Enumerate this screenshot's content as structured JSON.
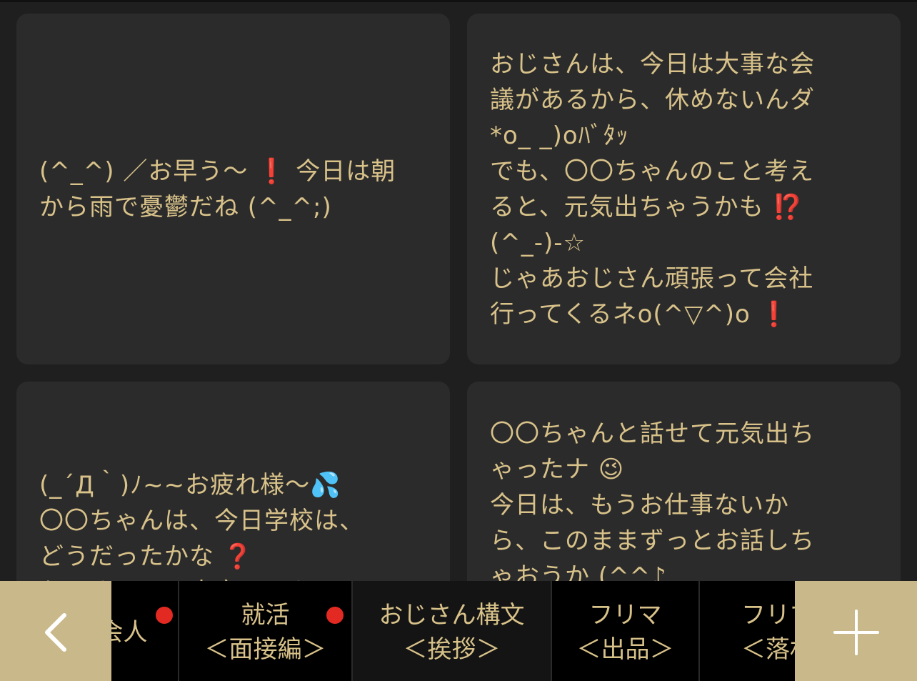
{
  "cards": [
    {
      "lines": [
        "(^_^) ／お早う～ ❗ 今日は朝",
        "から雨で憂鬱だね (^_^;)"
      ]
    },
    {
      "lines": [
        "おじさんは、今日は大事な会",
        "議があるから、休めないんダ",
        "*o_ _)oﾊﾞﾀｯ",
        "でも、〇〇ちゃんのこと考え",
        "ると、元気出ちゃうかも ⁉️",
        "(^_-)-☆",
        "じゃあおじさん頑張って会社",
        "行ってくるネo(^▽^)o ❗"
      ]
    },
    {
      "lines": [
        "(_´Д｀)ﾉ~~お疲れ様～💦",
        "〇〇ちゃんは、今日学校は、",
        "どうだったかな ❓",
        "おじさんは、大変だったよ…"
      ]
    },
    {
      "lines": [
        "〇〇ちゃんと話せて元気出ち",
        "ゃったナ 😉",
        "今日は、もうお仕事ないか",
        "ら、このままずっとお話しち",
        "ゃおうか (^^♪"
      ]
    }
  ],
  "tabbar": {
    "back_icon": "chevron-left-icon",
    "add_icon": "plus-icon",
    "tabs": [
      {
        "line1": "会人",
        "line2": "",
        "dot": true
      },
      {
        "line1": "就活",
        "line2": "＜面接編＞",
        "dot": true
      },
      {
        "line1": "おじさん構文",
        "line2": "＜挨拶＞",
        "dot": false
      },
      {
        "line1": "フリマ",
        "line2": "＜出品＞",
        "dot": false
      },
      {
        "line1": "フリマ",
        "line2": "＜落札",
        "dot": false
      }
    ]
  },
  "colors": {
    "background": "#1f1f1f",
    "card": "#2b2b2b",
    "text_gold": "#d8c28a",
    "button_gold": "#c9b98a",
    "notification_red": "#e32a22"
  }
}
